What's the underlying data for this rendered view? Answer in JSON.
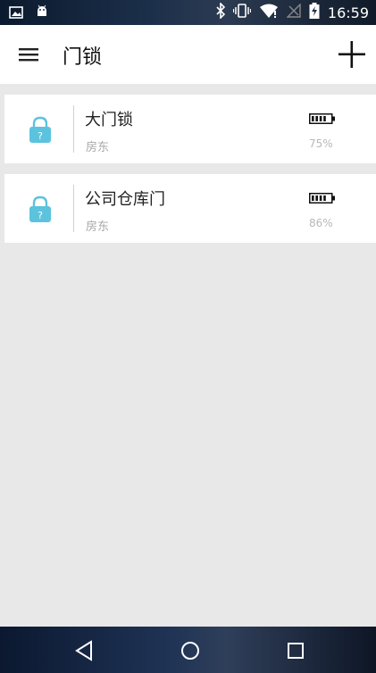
{
  "status_bar": {
    "time": "16:59",
    "left_icons": [
      "image-icon",
      "android-icon"
    ],
    "right_icons": [
      "bluetooth-icon",
      "vibrate-icon",
      "wifi-icon",
      "signal-icon",
      "battery-charging-icon"
    ]
  },
  "app_bar": {
    "menu_icon": "hamburger-menu-icon",
    "title": "门锁",
    "add_icon": "plus-icon"
  },
  "locks": [
    {
      "name": "大门锁",
      "owner": "房东",
      "battery_percent": "75%",
      "battery_level": 0.75
    },
    {
      "name": "公司仓库门",
      "owner": "房东",
      "battery_percent": "86%",
      "battery_level": 0.86
    }
  ],
  "nav_bar": {
    "back_icon": "back-triangle-icon",
    "home_icon": "home-circle-icon",
    "recents_icon": "recents-square-icon"
  },
  "colors": {
    "lock_icon": "#5bc3de",
    "background": "#e8e8e8",
    "card": "#ffffff"
  }
}
